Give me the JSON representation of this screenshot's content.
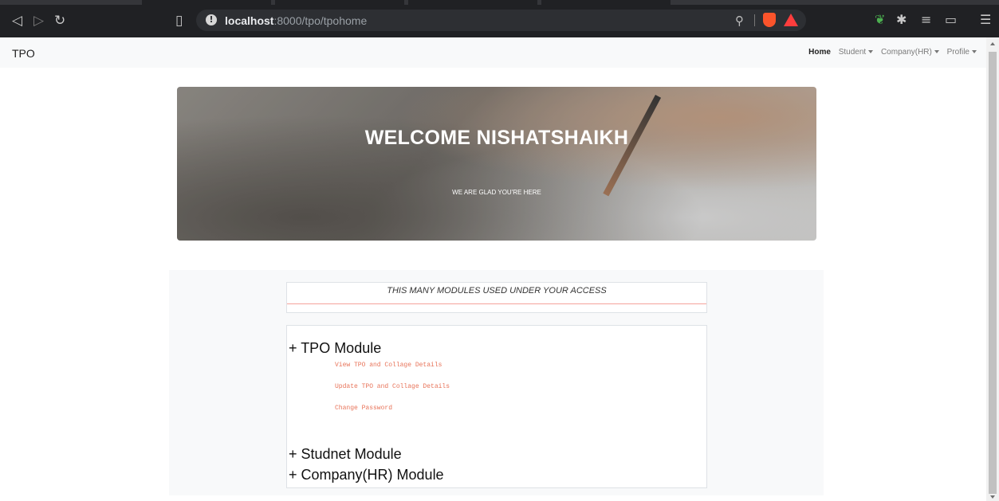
{
  "browser": {
    "url_host": "localhost",
    "url_path": ":8000/tpo/tpohome",
    "icons": [
      "back-icon",
      "forward-icon",
      "reload-icon",
      "bookmark-icon",
      "info-icon",
      "zoom-icon",
      "brave-shield-icon",
      "brave-rewards-icon",
      "extension-leaf-icon",
      "puzzle-icon",
      "playlist-icon",
      "wallet-icon",
      "menu-icon"
    ]
  },
  "navbar": {
    "brand": "TPO",
    "home": "Home",
    "student": "Student",
    "company": "Company(HR)",
    "profile": "Profile"
  },
  "hero": {
    "title": "WELCOME NISHATSHAIKH",
    "subtitle": "WE ARE GLAD YOU'RE HERE"
  },
  "modules": {
    "banner": "THIS MANY MODULES USED UNDER YOUR ACCESS",
    "tpo": {
      "title": "+ TPO Module",
      "links": [
        "View TPO and Collage Details",
        "Update TPO and Collage Details",
        "Change Password"
      ]
    },
    "student": {
      "title": "+ Studnet Module"
    },
    "company": {
      "title": "+ Company(HR) Module"
    }
  },
  "colors": {
    "link": "#e8745a",
    "navbar_bg": "#f8f9fa",
    "banner_line": "#f4a29b"
  }
}
